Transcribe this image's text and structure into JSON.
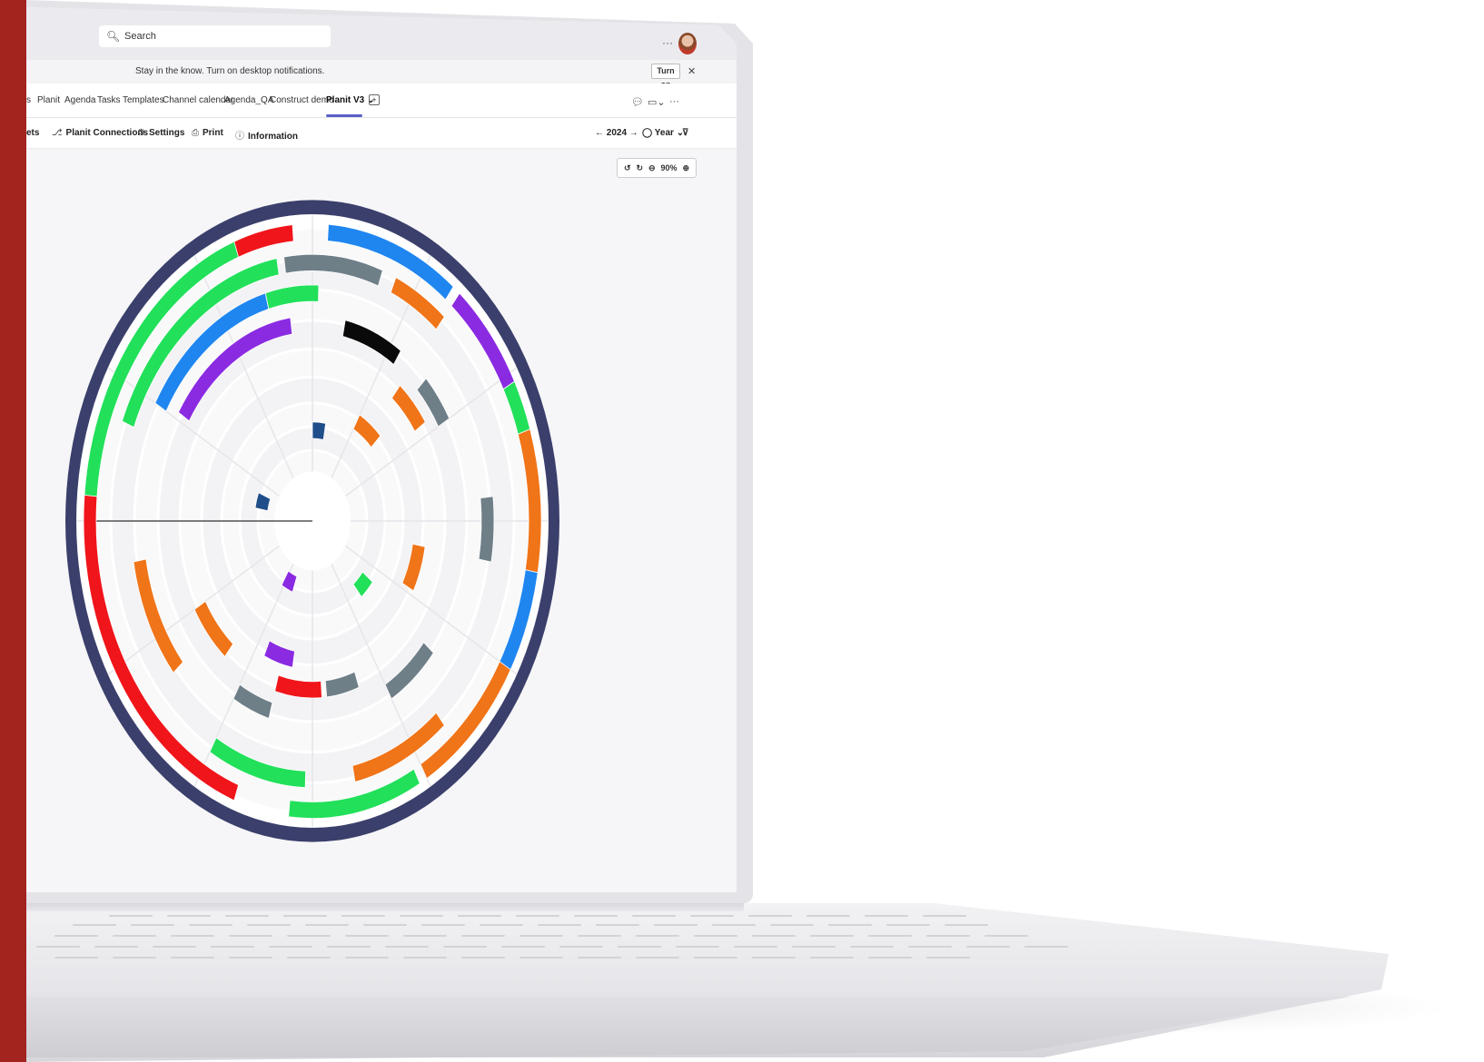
{
  "search": {
    "placeholder": "Search"
  },
  "topbar": {
    "more": "···"
  },
  "notification": {
    "text": "Stay in the know. Turn on desktop notifications.",
    "button": "Turn on",
    "close": "✕"
  },
  "tabs": [
    {
      "label": "s",
      "active": false
    },
    {
      "label": "Planit",
      "active": false
    },
    {
      "label": "Agenda",
      "active": false
    },
    {
      "label": "Tasks",
      "active": false
    },
    {
      "label": "Templates",
      "active": false
    },
    {
      "label": "Channel calendar",
      "active": false
    },
    {
      "label": "Agenda_QA",
      "active": false
    },
    {
      "label": "Construct demo",
      "active": false
    },
    {
      "label": "Planit V3 ⌄",
      "active": true
    }
  ],
  "tab_add": "+",
  "tab_right": {
    "chat_icon": "chat-icon",
    "video_icon": "video-icon",
    "more": "···"
  },
  "toolbar": {
    "items": [
      {
        "label": "ets",
        "icon": ""
      },
      {
        "label": "Planit Connections",
        "icon": "⎇"
      },
      {
        "label": "Settings",
        "icon": "⚙"
      },
      {
        "label": "Print",
        "icon": "⎙"
      },
      {
        "label": "Information",
        "icon": "ⓘ"
      }
    ],
    "year_nav": "← 2024 →",
    "view": "◯ Year ⌄",
    "filter_icon": "⊽"
  },
  "zoom": {
    "rotate_left": "↺",
    "rotate_right": "↻",
    "zoom_out": "⊖",
    "level": "90%",
    "zoom_in": "⊕"
  },
  "colors": {
    "brand_red": "#a3241e",
    "accent_purple": "#5b5fc7",
    "wheel_ring": "#3b3f6b",
    "green": "#22e05a",
    "red": "#f0151a",
    "blue": "#1f86f0",
    "orange": "#f07418",
    "purple": "#8a2be2",
    "gray": "#6f7f88",
    "black": "#0a0a0a"
  }
}
